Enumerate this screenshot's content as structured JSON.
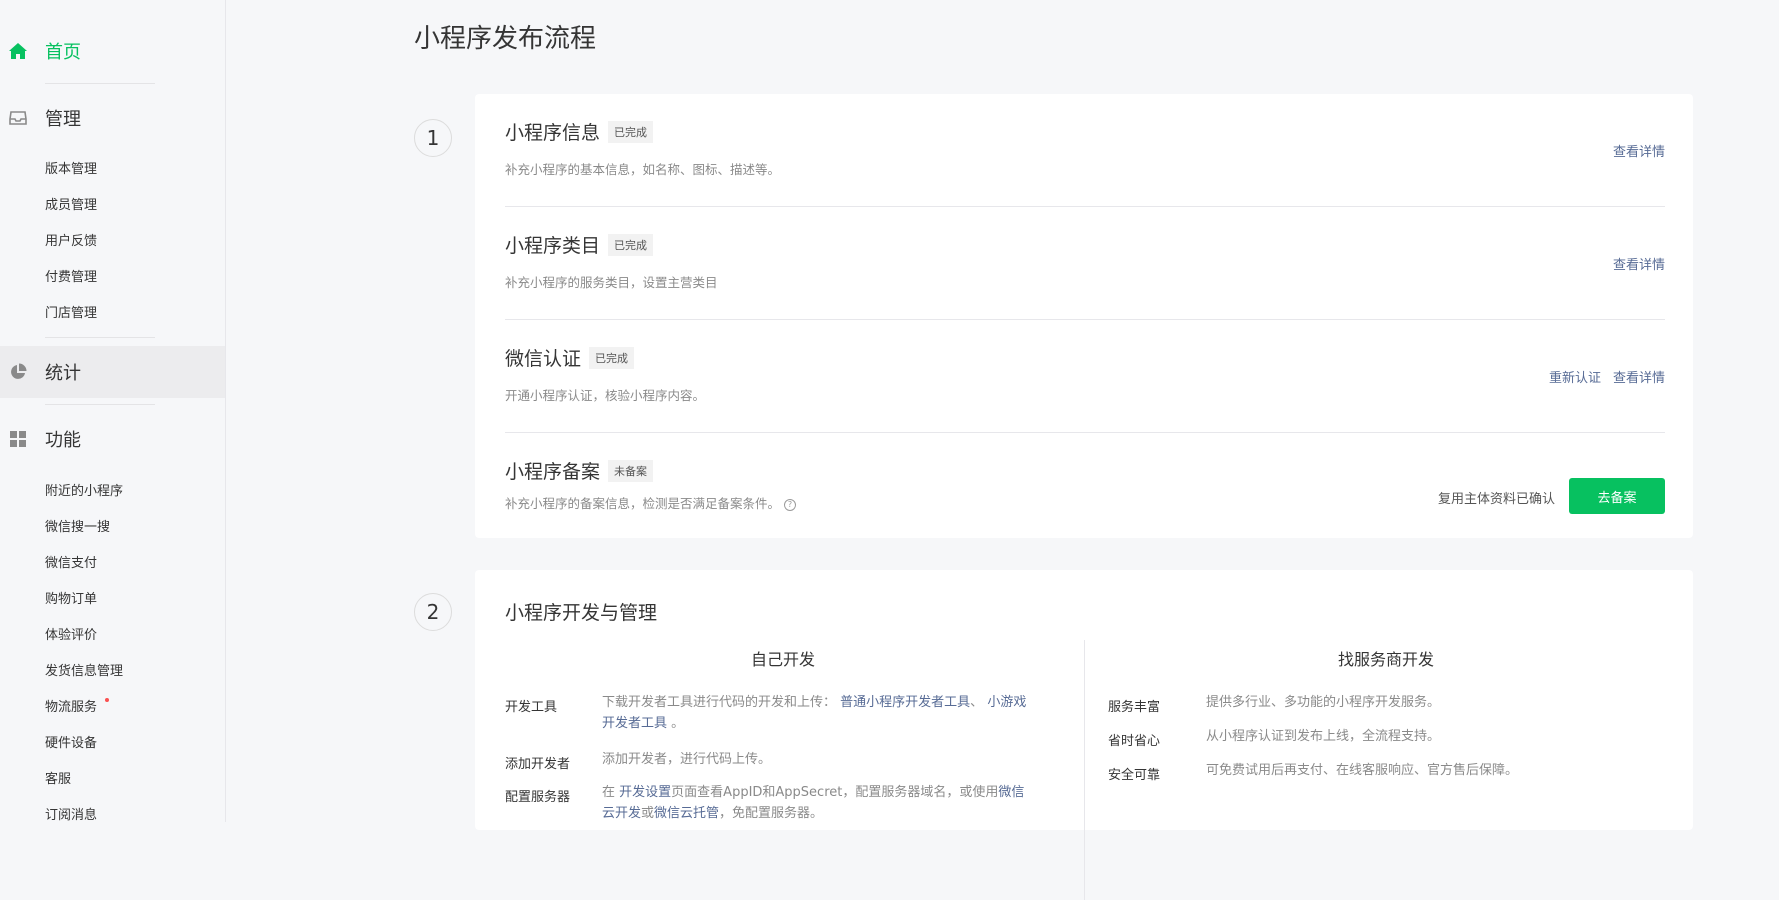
{
  "sidebar": {
    "home": "首页",
    "manage": {
      "label": "管理",
      "items": [
        "版本管理",
        "成员管理",
        "用户反馈",
        "付费管理",
        "门店管理"
      ]
    },
    "stats": "统计",
    "features": {
      "label": "功能",
      "items": [
        "附近的小程序",
        "微信搜一搜",
        "微信支付",
        "购物订单",
        "体验评价",
        "发货信息管理",
        "物流服务",
        "硬件设备",
        "客服",
        "订阅消息"
      ]
    }
  },
  "page": {
    "title": "小程序发布流程"
  },
  "step1": {
    "number": "1",
    "rows": [
      {
        "title": "小程序信息",
        "tag": "已完成",
        "desc": "补充小程序的基本信息，如名称、图标、描述等。",
        "action": "查看详情"
      },
      {
        "title": "小程序类目",
        "tag": "已完成",
        "desc": "补充小程序的服务类目，设置主营类目",
        "action": "查看详情"
      },
      {
        "title": "微信认证",
        "tag": "已完成",
        "desc": "开通小程序认证，核验小程序内容。",
        "action_secondary": "重新认证",
        "action": "查看详情"
      },
      {
        "title": "小程序备案",
        "tag": "未备案",
        "desc": "补充小程序的备案信息，检测是否满足备案条件。",
        "confirm_text": "复用主体资料已确认",
        "button": "去备案"
      }
    ]
  },
  "step2": {
    "number": "2",
    "title": "小程序开发与管理",
    "self_dev": {
      "heading": "自己开发",
      "rows": [
        {
          "label": "开发工具",
          "text1": "下载开发者工具进行代码的开发和上传：",
          "link1": "普通小程序开发者工具",
          "sep": "、",
          "link2a": "小游戏",
          "link2b": "开发者工具",
          "end": "。"
        },
        {
          "label": "添加开发者",
          "text": "添加开发者，进行代码上传。"
        },
        {
          "label": "配置服务器",
          "pre": "在",
          "link1": "开发设置",
          "mid": "页面查看AppID和AppSecret，配置服务器域名，或使用",
          "link2a": "微信",
          "link2b": "云开发",
          "or": "或",
          "link3": "微信云托管",
          "end": "，免配置服务器。"
        }
      ]
    },
    "provider_dev": {
      "heading": "找服务商开发",
      "rows": [
        {
          "label": "服务丰富",
          "text": "提供多行业、多功能的小程序开发服务。"
        },
        {
          "label": "省时省心",
          "text": "从小程序认证到发布上线，全流程支持。"
        },
        {
          "label": "安全可靠",
          "text": "可免费试用后再支付、在线客服响应、官方售后保障。"
        }
      ]
    }
  },
  "colors": {
    "accent": "#07c160",
    "link": "#576b95",
    "badge_dot": "#fa5151"
  }
}
